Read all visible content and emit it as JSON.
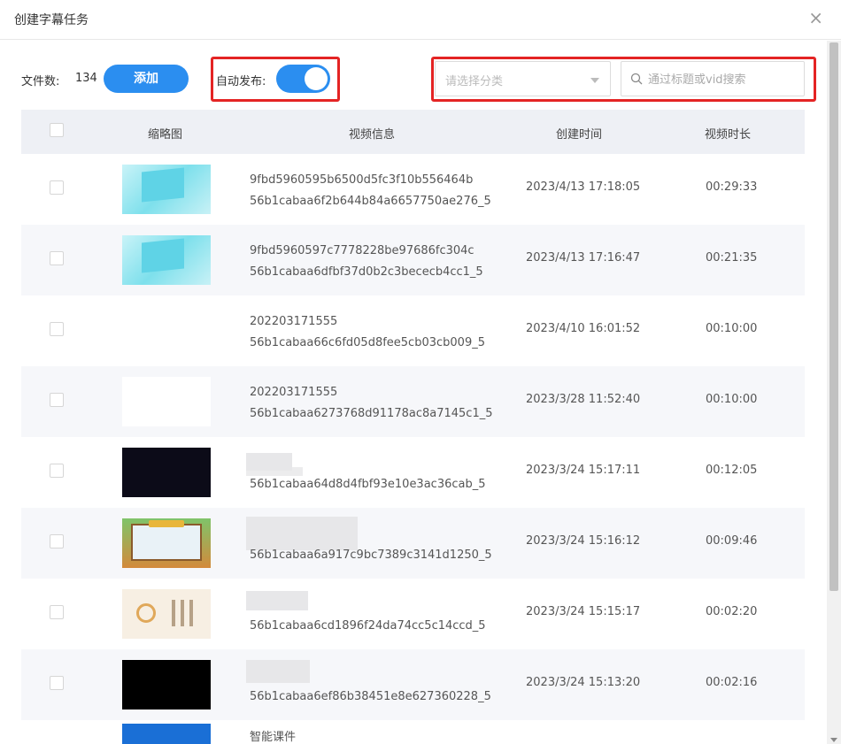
{
  "dialog": {
    "title": "创建字幕任务",
    "close_icon": "×"
  },
  "toolbar": {
    "file_count_label": "文件数:",
    "file_count_value": "134",
    "add_label": "添加",
    "auto_publish_label": "自动发布:",
    "auto_publish_on": true,
    "category_placeholder": "请选择分类",
    "search_placeholder": "通过标题或vid搜索"
  },
  "colors": {
    "accent": "#2b8ef0",
    "highlight": "#e42424",
    "header_bg": "#eef0f5"
  },
  "table": {
    "headers": [
      "缩略图",
      "视频信息",
      "创建时间",
      "视频时长"
    ],
    "rows": [
      {
        "line1": "9fbd5960595b6500d5fc3f10b556464b",
        "line2": "56b1cabaa6f2b644b84a6657750ae276_5",
        "time": "2023/4/13 17:18:05",
        "duration": "00:29:33",
        "thumb": "cyan"
      },
      {
        "line1": "9fbd5960597c7778228be97686fc304c",
        "line2": "56b1cabaa6dfbf37d0b2c3bececb4cc1_5",
        "time": "2023/4/13 17:16:47",
        "duration": "00:21:35",
        "thumb": "cyan"
      },
      {
        "line1": "202203171555",
        "line2": "56b1cabaa66c6fd05d8fee5cb03cb009_5",
        "time": "2023/4/10 16:01:52",
        "duration": "00:10:00",
        "thumb": "none"
      },
      {
        "line1": "202203171555",
        "line2": "56b1cabaa6273768d91178ac8a7145c1_5",
        "time": "2023/3/28 11:52:40",
        "duration": "00:10:00",
        "thumb": "white"
      },
      {
        "line1": "",
        "line2": "56b1cabaa64d8d4fbf93e10e3ac36cab_5",
        "time": "2023/3/24 15:17:11",
        "duration": "00:12:05",
        "thumb": "dark"
      },
      {
        "line1": "",
        "line2": "56b1cabaa6a917c9bc7389c3141d1250_5",
        "time": "2023/3/24 15:16:12",
        "duration": "00:09:46",
        "thumb": "board"
      },
      {
        "line1": "",
        "line2": "56b1cabaa6cd1896f24da74cc5c14ccd_5",
        "time": "2023/3/24 15:15:17",
        "duration": "00:02:20",
        "thumb": "beige"
      },
      {
        "line1": "",
        "line2": "56b1cabaa6ef86b38451e8e627360228_5",
        "time": "2023/3/24 15:13:20",
        "duration": "00:02:16",
        "thumb": "black"
      }
    ],
    "partial_row_text": "智能课件"
  }
}
